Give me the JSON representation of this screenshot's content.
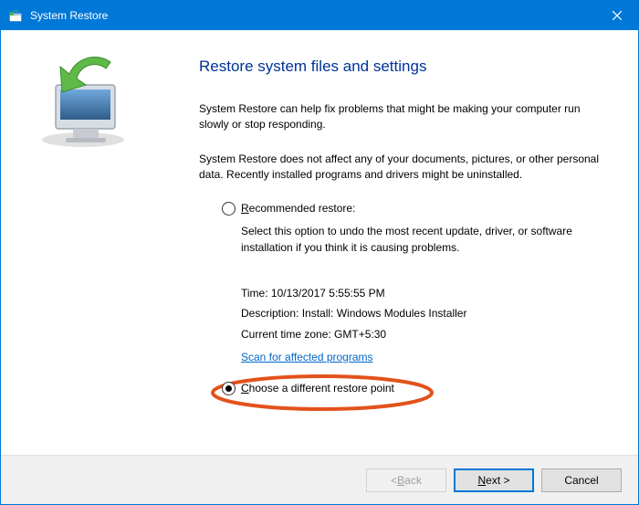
{
  "titlebar": {
    "title": "System Restore"
  },
  "content": {
    "heading": "Restore system files and settings",
    "para1": "System Restore can help fix problems that might be making your computer run slowly or stop responding.",
    "para2": "System Restore does not affect any of your documents, pictures, or other personal data. Recently installed programs and drivers might be uninstalled.",
    "recommended": {
      "label_pre": "R",
      "label_rest": "ecommended restore:",
      "desc": "Select this option to undo the most recent update, driver, or software installation if you think it is causing problems.",
      "time_label": "Time: ",
      "time_value": "10/13/2017 5:55:55 PM",
      "desc_label": "Description: ",
      "desc_value": "Install: Windows Modules Installer",
      "tz_label": "Current time zone: ",
      "tz_value": "GMT+5:30",
      "scan_link": "Scan for affected programs"
    },
    "choose": {
      "label_pre": "C",
      "label_rest": "hoose a different restore point"
    }
  },
  "footer": {
    "back_pre": "< ",
    "back_u": "B",
    "back_rest": "ack",
    "next_u": "N",
    "next_rest": "ext >",
    "cancel": "Cancel"
  }
}
